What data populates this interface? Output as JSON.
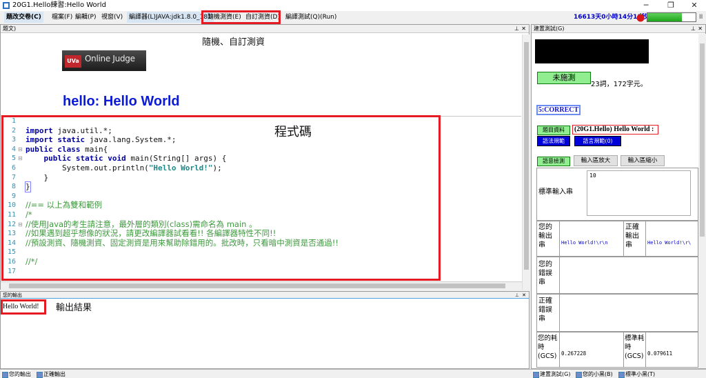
{
  "window": {
    "title": "20G1.Hello練習:Hello World",
    "minimize": "─",
    "maximize": "❐",
    "close": "✕"
  },
  "menu": {
    "items": [
      "題改交卷(C)",
      "檔案(F)",
      "編輯(P)",
      "視窗(V)",
      "編譯器(L)JAVA:jdk1.8.0_181",
      "隨機測資(E)",
      "自訂測資(D)",
      "編譯測試(Q)(Run)"
    ],
    "timer": "16613天0小時14分11秒",
    "pause": "II",
    "progress": 0.72
  },
  "left": {
    "panel_title": "題文)",
    "heading": "隨機、自訂測資",
    "logo_badge": "UVa",
    "logo_text": "Online Judge",
    "problem_title": "hello: Hello World",
    "code_annotation": "程式碼",
    "code": {
      "line_numbers": [
        "1",
        "2",
        "3",
        "4",
        "5",
        "6",
        "7",
        "8",
        "9",
        "10",
        "11",
        "12",
        "13",
        "14",
        "15",
        "16",
        "17"
      ],
      "l2a": "import",
      "l2b": " java.util.*;",
      "l3a": "import static",
      "l3b": " java.lang.System.*;",
      "l4a": "public class",
      "l4b": " main{",
      "l5a": "    public static void",
      "l5b": " main(String[] args) {",
      "l6a": "        System.out.println(",
      "l6b": "\"Hello World!\"",
      "l6c": ");",
      "l7": "    }",
      "l8": "}",
      "l10": "//== 以上為雙和範例",
      "l11": "/*",
      "l12": "//使用Java的考生請注意，最外層的類別(class)需命名為 main 。",
      "l13": "//如果遇到超乎想像的狀況，請更改編譯器試看看!! 各編譯器特性不同!!",
      "l14": "//預設測資、隨機測資、固定測資是用來幫助除錯用的。批改時，只看暗中測資是否通過!!",
      "l16": "//*/"
    },
    "output_title": "您的輸出",
    "output_text": "Hello World!",
    "output_annotation": "輸出結果"
  },
  "right": {
    "panel_title": "建置測試(G)",
    "unrun_label": "未施測",
    "word_count": "23詞，172字元。",
    "correct_label": "5:CORRECT",
    "problem_info_label": "題目資料",
    "problem_name": "(20G1.Hello) Hello World :",
    "syntax_label": "語法規範",
    "spec_label": "語言規範(0)",
    "test_label": "語意檢測",
    "enlarge_label": "輸入區放大",
    "shrink_label": "輸入區縮小",
    "stdin_label": "標準輸入串",
    "stdin_value": "10",
    "your_output_label": "您的輸出串",
    "your_output_value": "Hello World!\\r\\n",
    "correct_output_label": "正確輸出串",
    "correct_output_value": "Hello World!\\r\\",
    "your_error_label": "您的錯誤串",
    "correct_error_label": "正確錯誤串",
    "your_time_label": "您的耗時(GCS)",
    "your_time_value": "0.267228",
    "std_time_label": "標準耗時(GCS)",
    "std_time_value": "0.079611"
  },
  "bottom_tabs": [
    "您的輸出",
    "正確輸出",
    "建置測試(G)",
    "您的小黑(B)",
    "標準小黑(T)"
  ],
  "colors": {
    "annotation_red": "#e41b23",
    "keyword_blue": "#0000a0",
    "comment_green": "#3d9a3d",
    "title_blue": "#0b1ad4"
  }
}
